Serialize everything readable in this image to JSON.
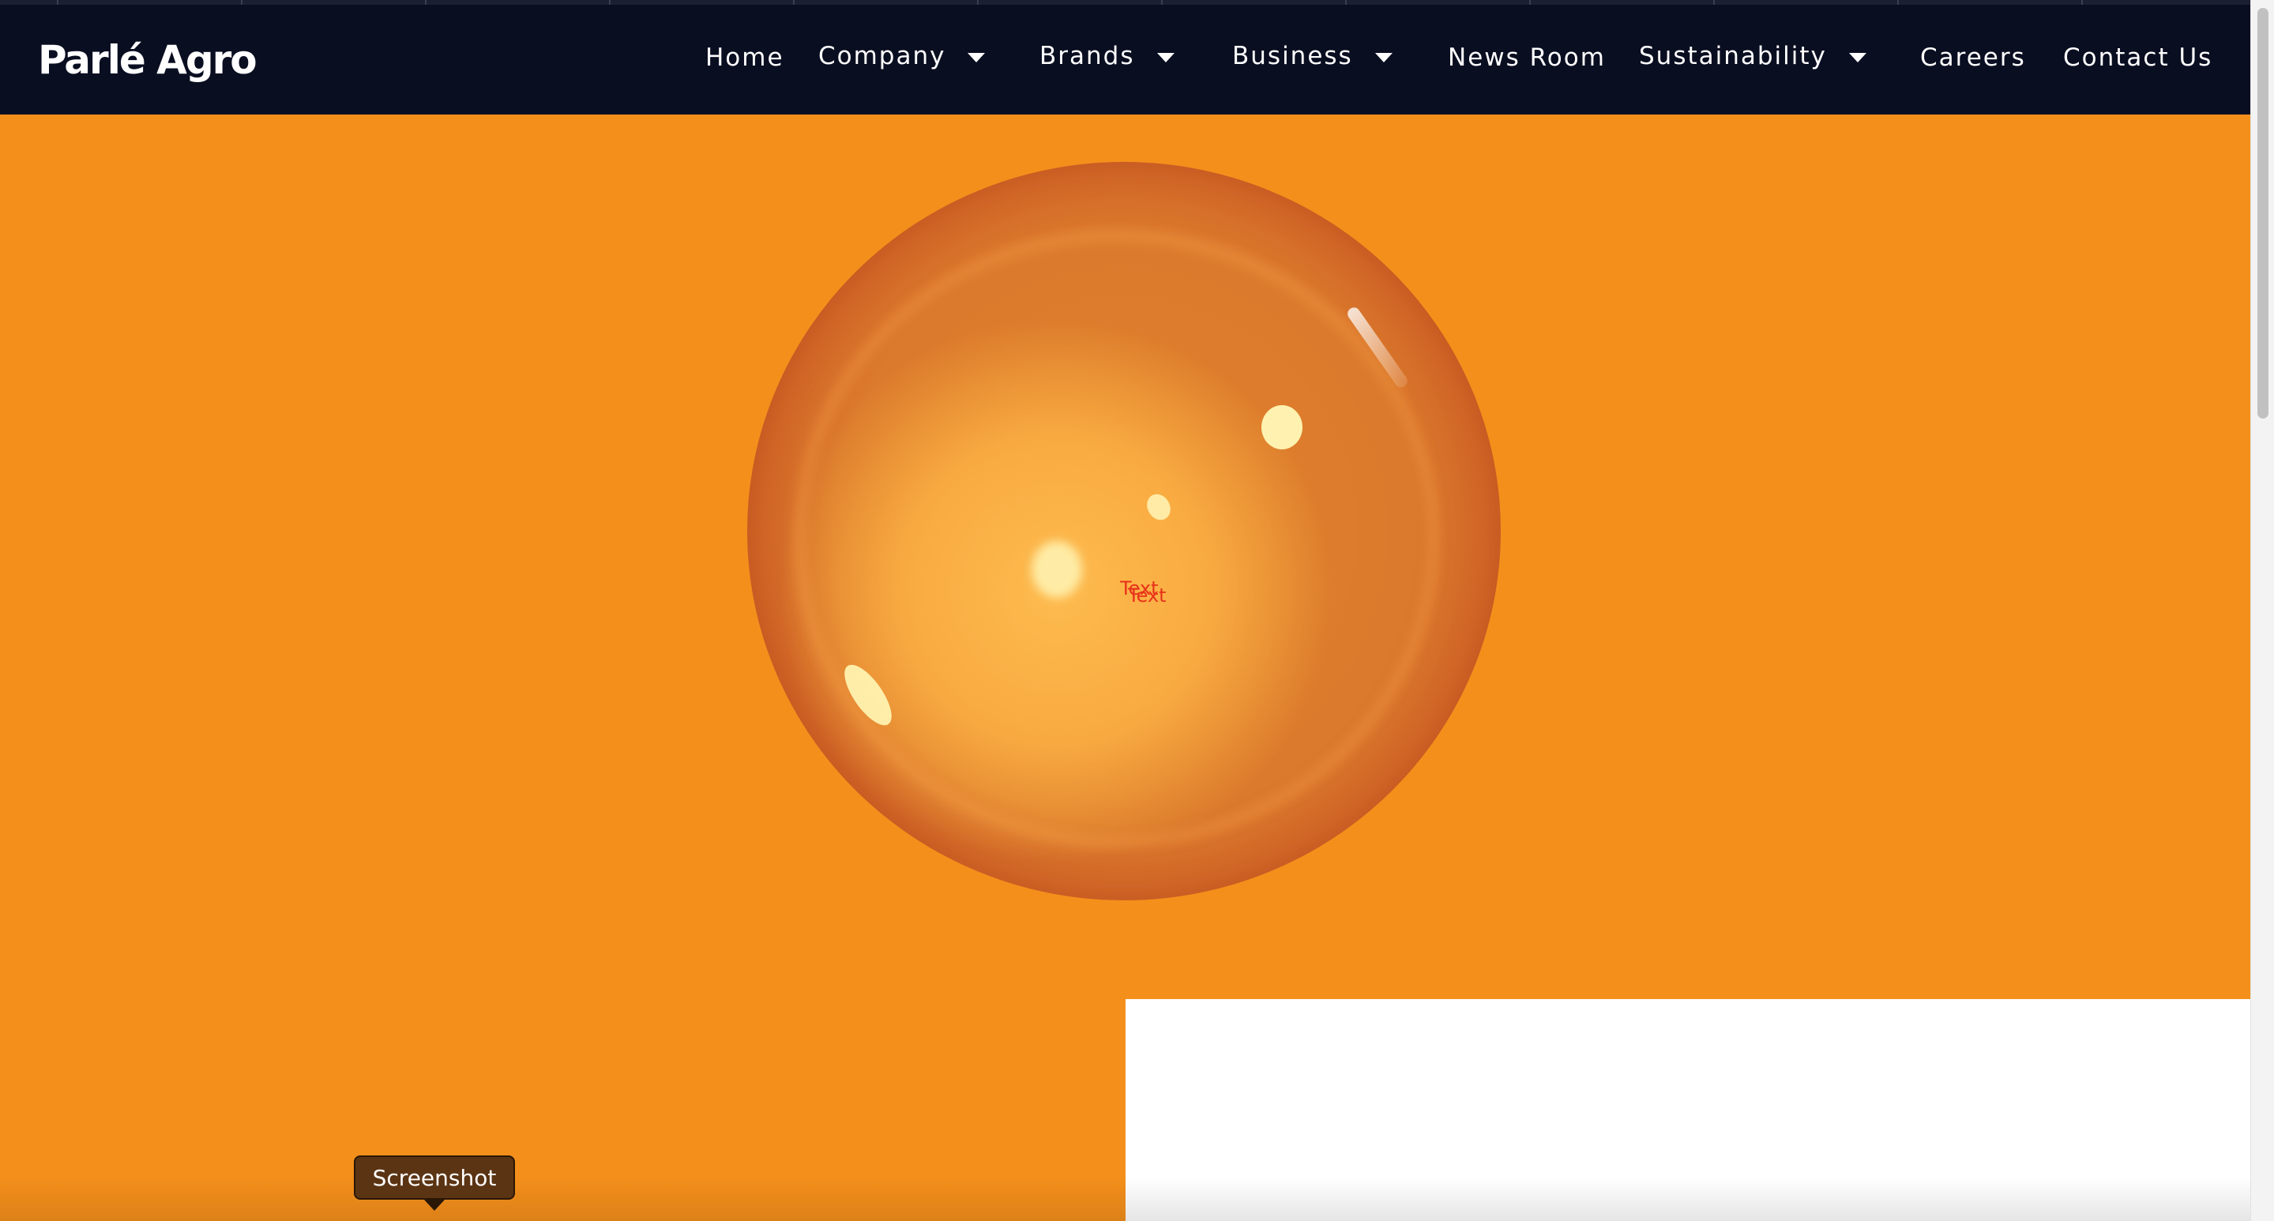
{
  "header": {
    "logo": "Parlé Agro",
    "nav": [
      {
        "label": "Home"
      },
      {
        "label": "Company"
      },
      {
        "label": "Brands"
      },
      {
        "label": "Business"
      },
      {
        "label": "News Room"
      },
      {
        "label": "Sustainability"
      },
      {
        "label": "Careers"
      },
      {
        "label": "Contact Us"
      }
    ]
  },
  "hero": {
    "text_a": "Text",
    "text_b": "Text"
  },
  "tooltip": {
    "label": "Screenshot"
  },
  "colors": {
    "header_bg": "#0a0e21",
    "page_bg": "#f48f1b",
    "overlay_text": "#e8321a"
  }
}
